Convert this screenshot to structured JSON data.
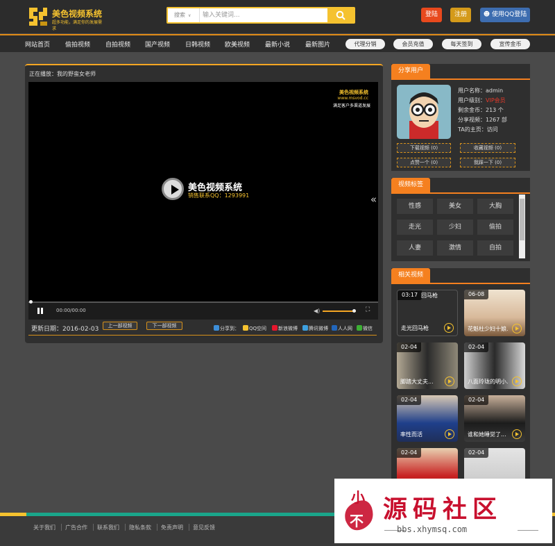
{
  "brand": {
    "title": "美色视频系统",
    "slogan": "超多功能，满足你的发展需求"
  },
  "search": {
    "category": "搜索",
    "placeholder": "输入关键词..."
  },
  "header": {
    "login": "登陆",
    "register": "注册",
    "qq_login": "使用QQ登陆"
  },
  "nav": {
    "items": [
      "网站首页",
      "偷拍视频",
      "自拍视频",
      "国产视频",
      "日韩视频",
      "欧美视频",
      "最新小说",
      "最新图片"
    ],
    "pills": [
      "代理分销",
      "会员充值",
      "每天签到",
      "宣传金币"
    ]
  },
  "player": {
    "now_playing": "正在播放：我的野蛮女老师",
    "watermark_title": "美色视频系统",
    "watermark_url": "www.msvod.cc",
    "watermark_sub": "满足客户多渠道发展",
    "center_title": "美色视频系统",
    "center_sub": "销售联系QQ：1293991",
    "time": "00:00/00:00",
    "volume_level": 0.85,
    "progress": 0
  },
  "video_info": {
    "date": "更新日期：2016-02-03",
    "prev": "上一部视频",
    "next": "下一部视频",
    "share_label": "分享到：",
    "share_targets": [
      "QQ空间",
      "新浪微博",
      "腾讯微博",
      "人人网",
      "微信"
    ]
  },
  "share_user": {
    "heading": "分享用户",
    "username": "用户名称：admin",
    "level_label": "用户级别：",
    "level_value": "VIP会员",
    "coins": "剩余金币：213 个",
    "videos": "分享视频：1267 部",
    "home": "TA的主页：访问",
    "buttons": [
      "下载视频 (0)",
      "收藏视频 (0)",
      "点赞一个 (0)",
      "我踩一下 (0)"
    ]
  },
  "tags": {
    "heading": "视频标签",
    "items": [
      "性感",
      "美女",
      "大胸",
      "走光",
      "少妇",
      "偷拍",
      "人妻",
      "激情",
      "自拍"
    ]
  },
  "related": {
    "heading": "相关视频",
    "items": [
      {
        "date": "03:17",
        "title": "走光回马枪",
        "broken_label": "回马枪"
      },
      {
        "date": "06-08",
        "title": "花魁杜少妇十娘..."
      },
      {
        "date": "02-04",
        "title": "脚踏大丈夫..."
      },
      {
        "date": "02-04",
        "title": "八面玲珑的明小..."
      },
      {
        "date": "02-04",
        "title": "率性而活"
      },
      {
        "date": "02-04",
        "title": "谁和她睡觉了..."
      },
      {
        "date": "02-04",
        "title": ""
      },
      {
        "date": "02-04",
        "title": ""
      }
    ]
  },
  "footer": {
    "links": [
      "关于我们",
      "广告合作",
      "联系我们",
      "隐私条款",
      "免责声明",
      "意见反馈"
    ]
  },
  "watermark": {
    "big": "源码社区",
    "url": "bbs.xhymsq.com",
    "seal_chars": "小不"
  },
  "colors": {
    "accent": "#f5a623",
    "orange": "#f5801f",
    "yellow": "#f5c22f",
    "login": "#e8491d",
    "register": "#e8a21d",
    "qq": "#3d6db0"
  }
}
